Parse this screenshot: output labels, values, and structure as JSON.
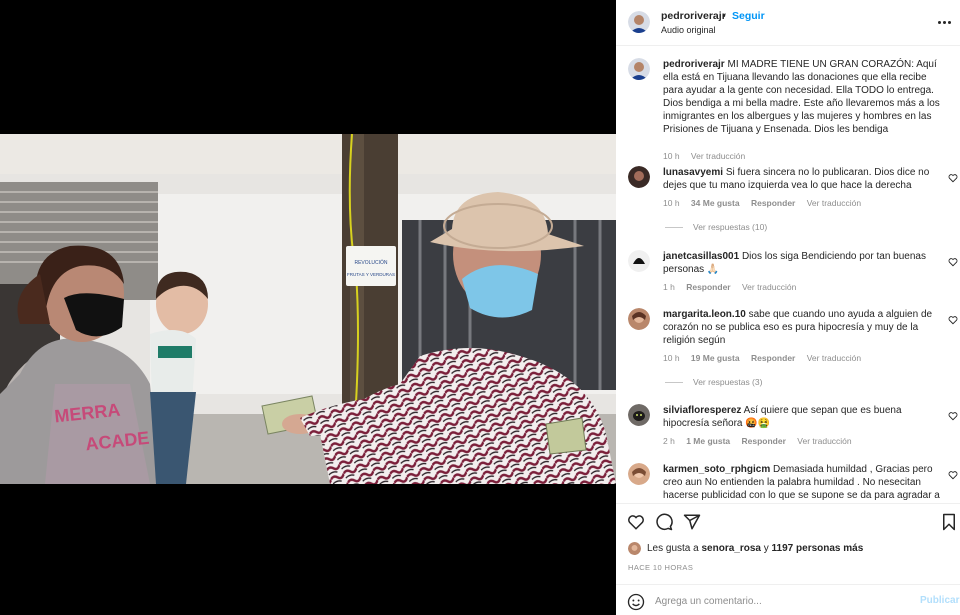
{
  "post": {
    "username": "pedroriverajr",
    "separator": "•",
    "follow_label": "Seguir",
    "audio": "Audio original",
    "caption_user": "pedroriverajr",
    "caption": "MI MADRE TIENE UN GRAN CORAZÓN: Aquí ella está en Tijuana llevando las donaciones que ella recibe para ayudar a la gente con necesidad. Ella TODO lo entrega. Dios bendiga a mi bella madre. Este año llevaremos más a los inmigrantes en los albergues y las mujeres y hombres en las Prisiones de Tijuana y Ensenada. Dios les bendiga",
    "caption_time": "10 h",
    "translate_label": "Ver traducción",
    "likes_prefix": "Les gusta a",
    "likes_user": "senora_rosa",
    "likes_middle": "y",
    "likes_count": "1197 personas más",
    "timestamp": "HACE 10 HORAS",
    "comment_placeholder": "Agrega un comentario...",
    "publish_label": "Publicar"
  },
  "comments": [
    {
      "user": "lunasavyemi",
      "text": "Si fuera sincera no lo publicaran. Dios dice no dejes que tu mano izquierda vea lo que hace la derecha",
      "time": "10 h",
      "likes": "34 Me gusta",
      "reply": "Responder",
      "translate": "Ver traducción",
      "replies": "Ver respuestas (10)"
    },
    {
      "user": "janetcasillas001",
      "text": "Dios los siga Bendiciendo por tan buenas personas 🙏🏻",
      "time": "1 h",
      "reply": "Responder",
      "translate": "Ver traducción"
    },
    {
      "user": "margarita.leon.10",
      "text": "sabe que cuando uno ayuda a alguien de corazón no se publica eso es pura hipocresía y muy de la religión según",
      "time": "10 h",
      "likes": "19 Me gusta",
      "reply": "Responder",
      "translate": "Ver traducción",
      "replies": "Ver respuestas (3)"
    },
    {
      "user": "silviafloresperez",
      "text": "Así quiere que sepan que es buena hipocresía señora 🤬🤮",
      "time": "2 h",
      "likes": "1 Me gusta",
      "reply": "Responder",
      "translate": "Ver traducción"
    },
    {
      "user": "karmen_soto_rphgicm",
      "text": "Demasiada humildad , Gracias pero creo aun No entienden la palabra humildad . No nesecitan hacerse publicidad con lo que se supone se da para agradar a"
    }
  ],
  "video": {
    "sign_text": "REVOLUCIÓN FRUTAS Y VERDURAS"
  },
  "colors": {
    "link": "#0095f6",
    "muted": "#8e8e8e",
    "text": "#262626",
    "publish_disabled": "#b2dffc"
  },
  "icons": [
    "mute-icon",
    "more-icon",
    "heart-icon",
    "comment-icon",
    "share-icon",
    "bookmark-icon",
    "emoji-icon"
  ]
}
